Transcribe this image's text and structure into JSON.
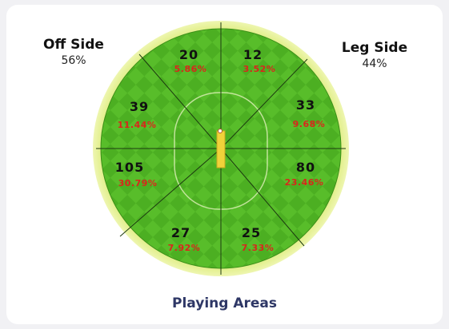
{
  "off_side": {
    "label": "Off Side",
    "percent": "56%"
  },
  "leg_side": {
    "label": "Leg Side",
    "percent": "44%"
  },
  "zones": [
    {
      "runs": "20",
      "percent": "5.86%"
    },
    {
      "runs": "12",
      "percent": "3.52%"
    },
    {
      "runs": "33",
      "percent": "9.68%"
    },
    {
      "runs": "80",
      "percent": "23.46%"
    },
    {
      "runs": "25",
      "percent": "7.33%"
    },
    {
      "runs": "27",
      "percent": "7.92%"
    },
    {
      "runs": "105",
      "percent": "30.79%"
    },
    {
      "runs": "39",
      "percent": "11.44%"
    }
  ],
  "footer": {
    "title": "Playing Areas"
  },
  "colors": {
    "field_dark": "#3f9a1c",
    "field_light": "#5cbf2a",
    "boundary": "#e4ef8a",
    "percent_text": "#d9261c",
    "title": "#2e3766"
  }
}
